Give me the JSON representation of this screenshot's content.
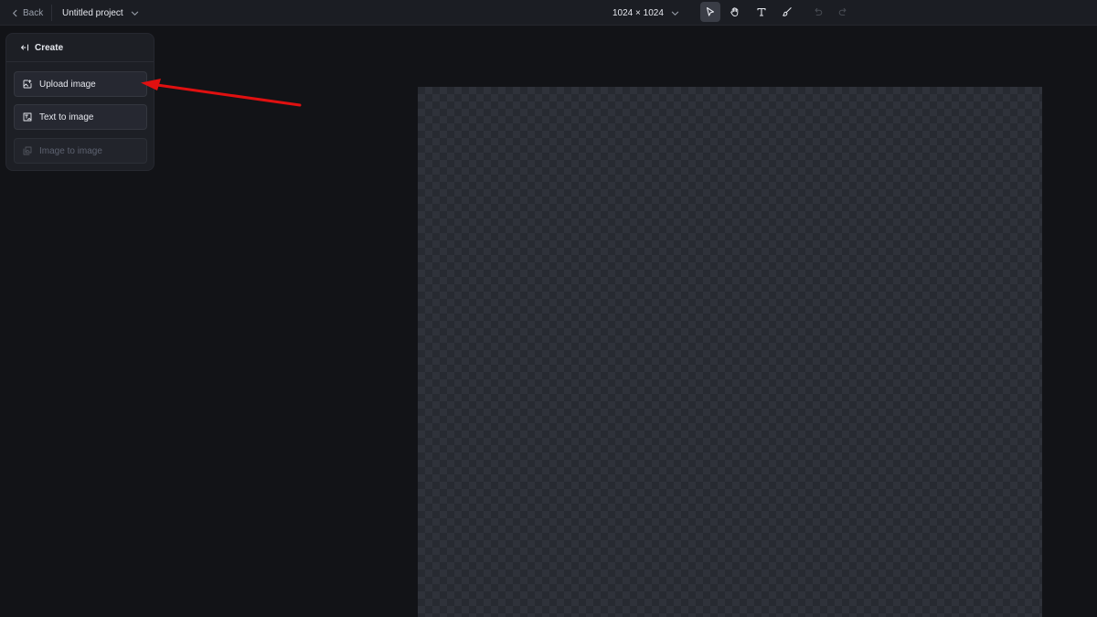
{
  "topbar": {
    "back_label": "Back",
    "project_name": "Untitled project",
    "canvas_size": "1024 × 1024",
    "tools": [
      {
        "name": "select-icon",
        "active": true
      },
      {
        "name": "hand-icon",
        "active": false
      },
      {
        "name": "text-icon",
        "active": false
      },
      {
        "name": "brush-icon",
        "active": false
      },
      {
        "name": "undo-icon",
        "disabled": true
      },
      {
        "name": "redo-icon",
        "disabled": true
      }
    ]
  },
  "create_panel": {
    "title": "Create",
    "items": [
      {
        "label": "Upload image",
        "icon": "upload-image-icon",
        "enabled": true
      },
      {
        "label": "Text to image",
        "icon": "text-to-image-icon",
        "enabled": true
      },
      {
        "label": "Image to image",
        "icon": "image-to-image-icon",
        "enabled": false
      }
    ]
  },
  "colors": {
    "background": "#121317",
    "topbar": "#1b1d23",
    "panel": "#1d1f25",
    "annotation": "#e01010"
  }
}
